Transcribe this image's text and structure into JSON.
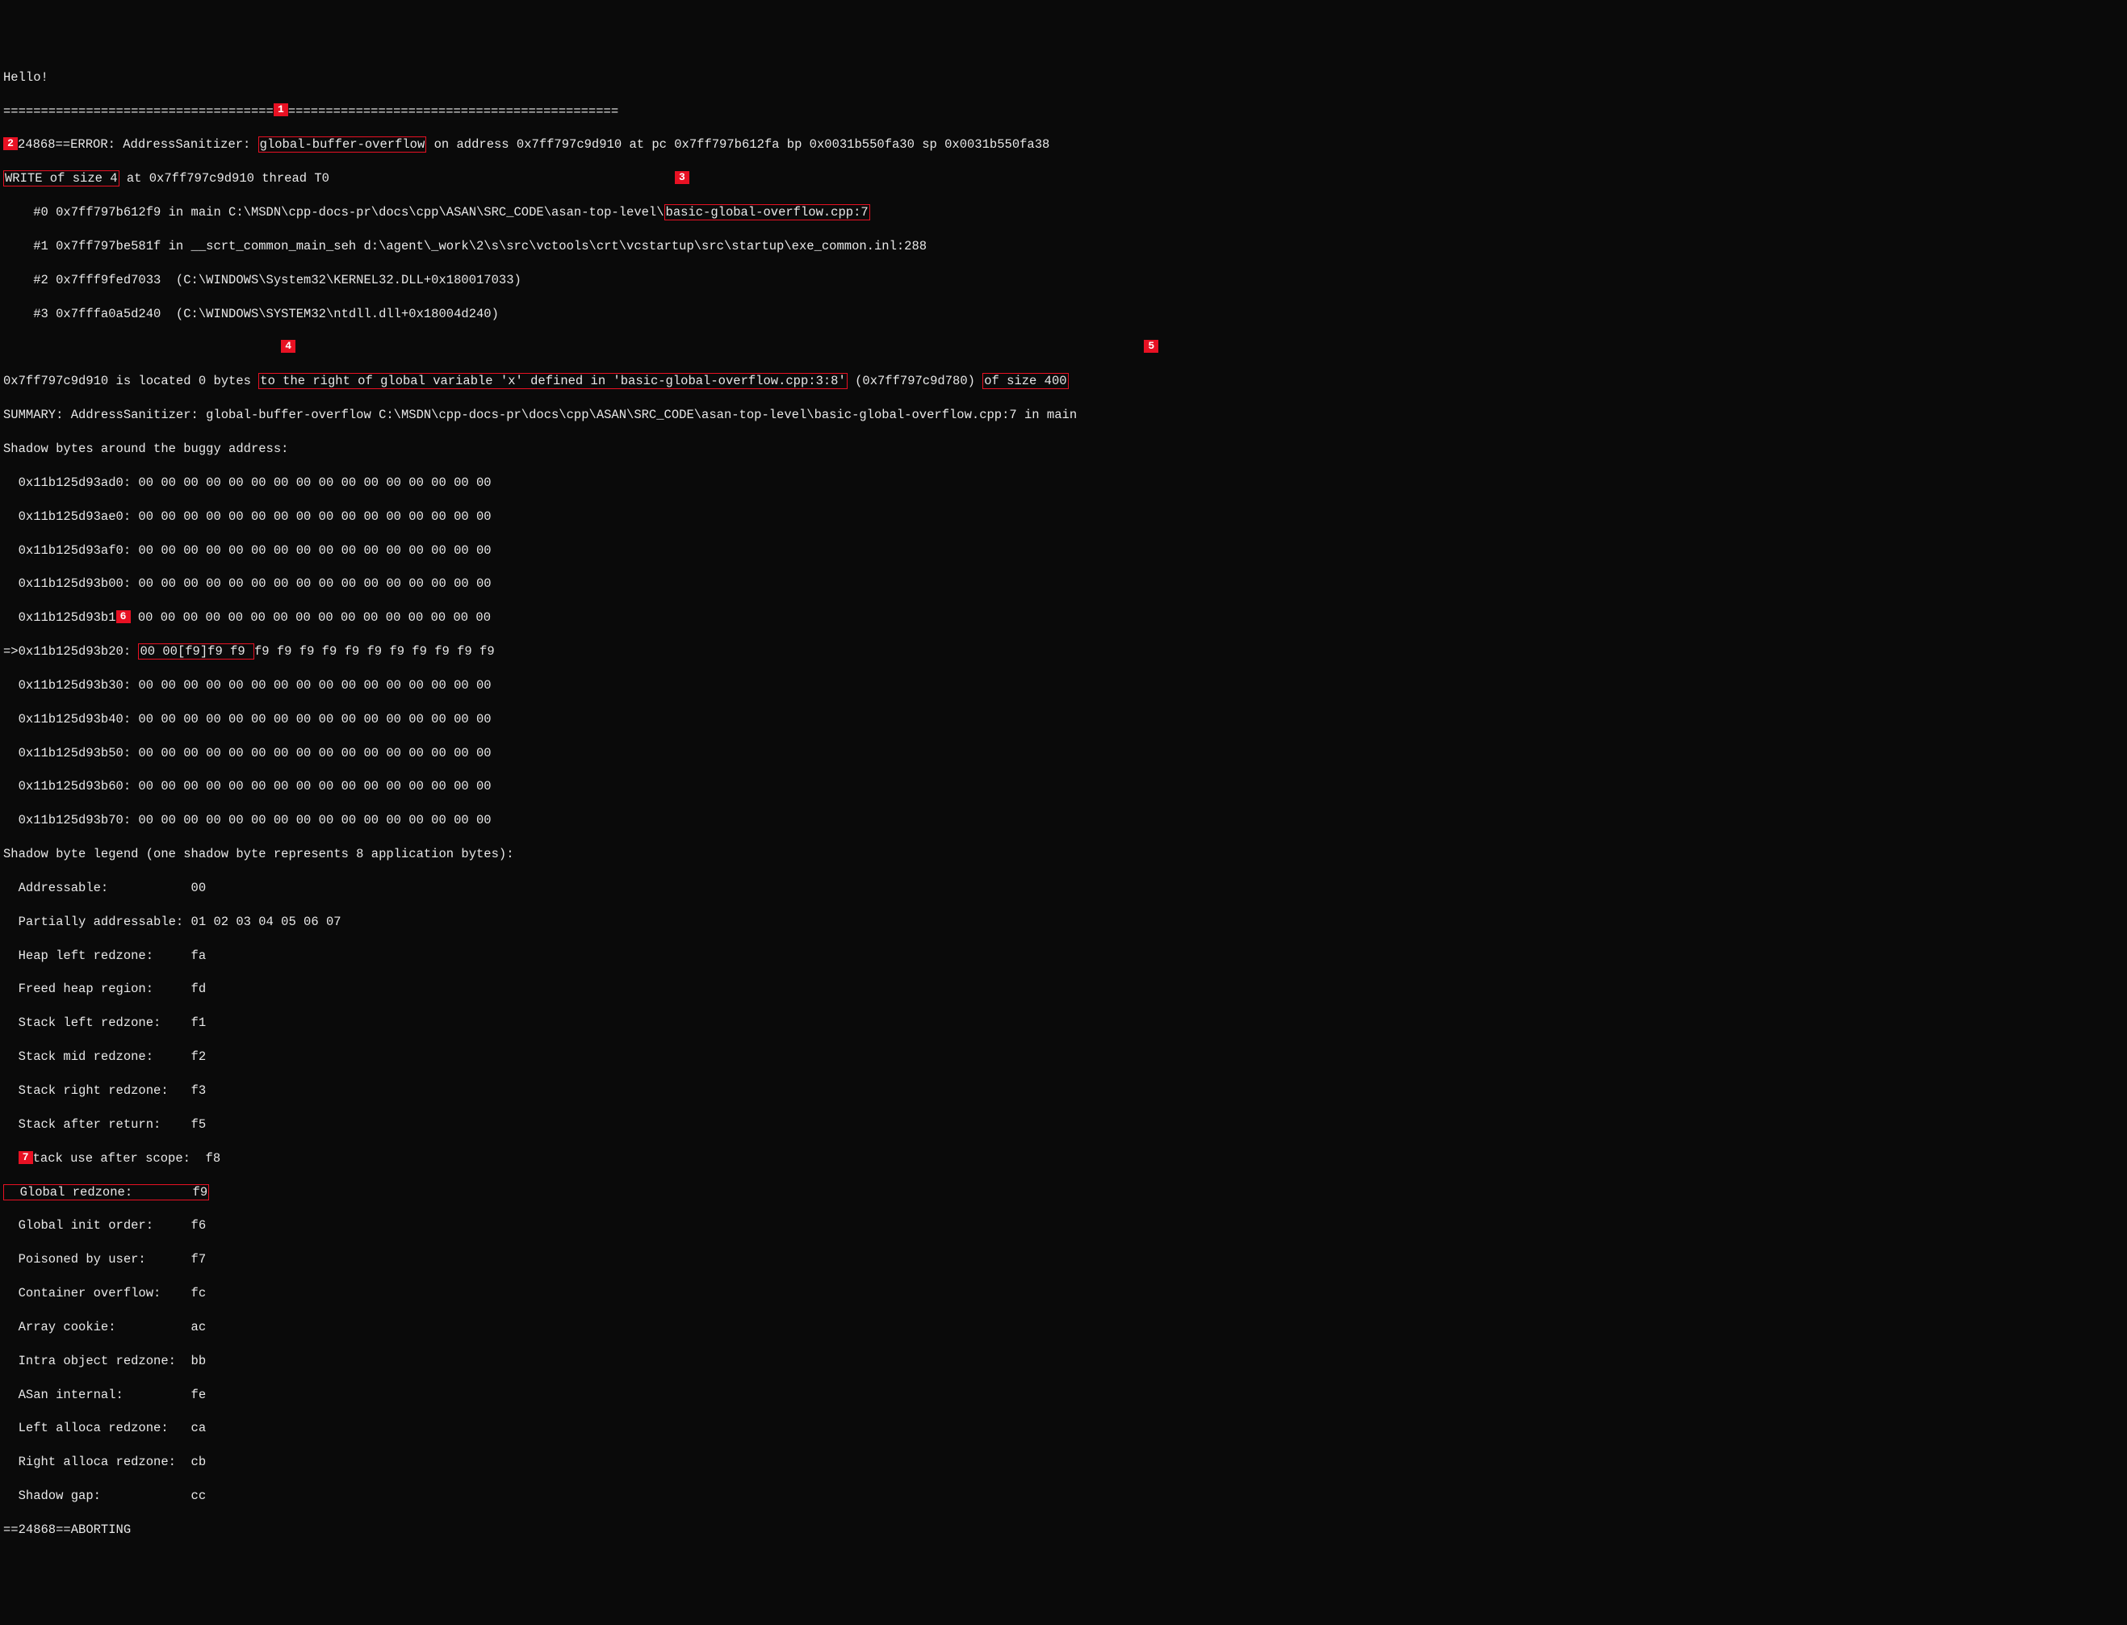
{
  "greeting": "Hello!",
  "callouts": {
    "c1": "1",
    "c2": "2",
    "c3": "3",
    "c4": "4",
    "c5": "5",
    "c6": "6",
    "c7": "7"
  },
  "hr_left": "====================================",
  "hr_right": "============================================",
  "err": {
    "prefix": "24868==ERROR: AddressSanitizer: ",
    "type": "global-buffer-overflow",
    "tail": " on address 0x7ff797c9d910 at pc 0x7ff797b612fa bp 0x0031b550fa30 sp 0x0031b550fa38"
  },
  "write": {
    "desc": "WRITE of size 4",
    "tail": " at 0x7ff797c9d910 thread T0"
  },
  "stack": {
    "f0a": "    #0 0x7ff797b612f9 in main C:\\MSDN\\cpp-docs-pr\\docs\\cpp\\ASAN\\SRC_CODE\\asan-top-level\\",
    "f0b": "basic-global-overflow.cpp:7",
    "f1": "    #1 0x7ff797be581f in __scrt_common_main_seh d:\\agent\\_work\\2\\s\\src\\vctools\\crt\\vcstartup\\src\\startup\\exe_common.inl:288",
    "f2": "    #2 0x7fff9fed7033  (C:\\WINDOWS\\System32\\KERNEL32.DLL+0x180017033)",
    "f3": "    #3 0x7fffa0a5d240  (C:\\WINDOWS\\SYSTEM32\\ntdll.dll+0x18004d240)"
  },
  "loc": {
    "pre": "0x7ff797c9d910 is located 0 bytes ",
    "mid": "to the right of global variable 'x' defined in 'basic-global-overflow.cpp:3:8'",
    "addr": " (0x7ff797c9d780) ",
    "size": "of size 400"
  },
  "summary": "SUMMARY: AddressSanitizer: global-buffer-overflow C:\\MSDN\\cpp-docs-pr\\docs\\cpp\\ASAN\\SRC_CODE\\asan-top-level\\basic-global-overflow.cpp:7 in main",
  "shadow_hdr": "Shadow bytes around the buggy address:",
  "shadow": {
    "r0": "  0x11b125d93ad0: 00 00 00 00 00 00 00 00 00 00 00 00 00 00 00 00",
    "r1": "  0x11b125d93ae0: 00 00 00 00 00 00 00 00 00 00 00 00 00 00 00 00",
    "r2": "  0x11b125d93af0: 00 00 00 00 00 00 00 00 00 00 00 00 00 00 00 00",
    "r3": "  0x11b125d93b00: 00 00 00 00 00 00 00 00 00 00 00 00 00 00 00 00",
    "r4a": "  0x11b125d93b1",
    "r4b": " 00 00 00 00 00 00 00 00 00 00 00 00 00 00 00 00",
    "r5a": "=>0x11b125d93b20: ",
    "r5b": "00 00[f9]f9 f9 ",
    "r5c": "f9 f9 f9 f9 f9 f9 f9 f9 f9 f9 f9",
    "r6": "  0x11b125d93b30: 00 00 00 00 00 00 00 00 00 00 00 00 00 00 00 00",
    "r7": "  0x11b125d93b40: 00 00 00 00 00 00 00 00 00 00 00 00 00 00 00 00",
    "r8": "  0x11b125d93b50: 00 00 00 00 00 00 00 00 00 00 00 00 00 00 00 00",
    "r9": "  0x11b125d93b60: 00 00 00 00 00 00 00 00 00 00 00 00 00 00 00 00",
    "r10": "  0x11b125d93b70: 00 00 00 00 00 00 00 00 00 00 00 00 00 00 00 00"
  },
  "legend_hdr": "Shadow byte legend (one shadow byte represents 8 application bytes):",
  "legend": {
    "l0": "  Addressable:           00",
    "l1": "  Partially addressable: 01 02 03 04 05 06 07",
    "l2": "  Heap left redzone:     fa",
    "l3": "  Freed heap region:     fd",
    "l4": "  Stack left redzone:    f1",
    "l5": "  Stack mid redzone:     f2",
    "l6": "  Stack right redzone:   f3",
    "l7": "  Stack after return:    f5",
    "l8a": "tack use after scope:  f8",
    "l9": "  Global redzone:        f9",
    "l10": "  Global init order:     f6",
    "l11": "  Poisoned by user:      f7",
    "l12": "  Container overflow:    fc",
    "l13": "  Array cookie:          ac",
    "l14": "  Intra object redzone:  bb",
    "l15": "  ASan internal:         fe",
    "l16": "  Left alloca redzone:   ca",
    "l17": "  Right alloca redzone:  cb",
    "l18": "  Shadow gap:            cc"
  },
  "abort": "==24868==ABORTING"
}
